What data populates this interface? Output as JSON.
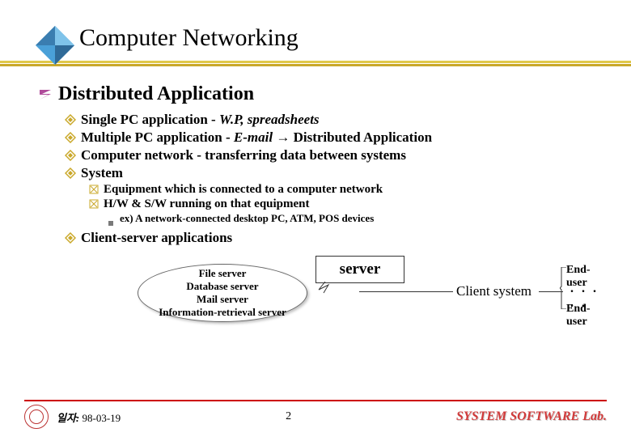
{
  "title": "Computer Networking",
  "section": {
    "heading": "Distributed Application",
    "items": [
      {
        "prefix": "Single PC application - ",
        "italic": "W.P, spreadsheets",
        "suffix": ""
      },
      {
        "prefix": "Multiple PC application - ",
        "italic": "E-mail",
        "arrow": " → ",
        "suffix": "Distributed Application"
      },
      {
        "prefix": "Computer network - transferring data between systems",
        "italic": "",
        "suffix": ""
      },
      {
        "prefix": "System",
        "italic": "",
        "suffix": ""
      }
    ],
    "system_sub": [
      "Equipment which is connected to a computer network",
      "H/W & S/W running on that equipment"
    ],
    "example": "ex) A network-connected desktop PC, ATM, POS devices",
    "client_server_heading": "Client-server applications"
  },
  "diagram": {
    "oval_lines": [
      "File server",
      "Database server",
      "Mail server",
      "Information-retrieval server"
    ],
    "callout": "server",
    "client": "Client system",
    "enduser": "End-user",
    "dots": ". . . . ."
  },
  "footer": {
    "date_label": "일자:",
    "date_value": "98-03-19",
    "page": "2",
    "lab": "SYSTEM SOFTWARE Lab."
  }
}
